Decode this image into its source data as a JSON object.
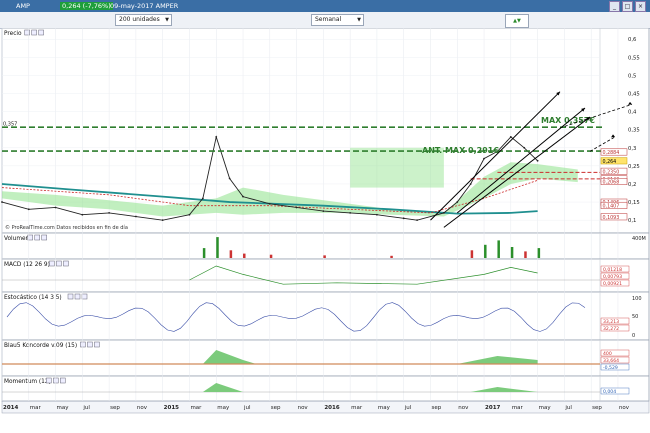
{
  "window": {
    "title": "AMP",
    "change": "0,264 (-7,76%)",
    "date_label": "09-may-2017 AMPER",
    "controls": [
      "_",
      "□",
      "×"
    ]
  },
  "toolbar": {
    "units_select": "200 unidades",
    "period_select": "Semanal"
  },
  "panels": {
    "price_label": "Precio",
    "prt_note": "© ProRealTime.com  Datos recibidos en fin de día",
    "volume_label": "Volumen",
    "macd_label": "MACD (12 26 9)",
    "stoch_label": "Estocástico (14 3 5)",
    "blau_label": "Blau5 Koncorde v.09 (15)",
    "momentum_label": "Momentum (12)"
  },
  "annotations": {
    "max_label": "MAX 0,357€",
    "ant_max_label": "ANT. MAX 0,291€",
    "left_level": "0,357"
  },
  "chart_data": {
    "type": "line",
    "title": "AMPER",
    "period": "Semanal",
    "x_ticks": [
      "2014",
      "mar",
      "may",
      "jul",
      "sep",
      "nov",
      "2015",
      "mar",
      "may",
      "jul",
      "sep",
      "nov",
      "2016",
      "mar",
      "may",
      "jul",
      "sep",
      "nov",
      "2017",
      "mar",
      "may",
      "jul",
      "sep",
      "nov"
    ],
    "y_ticks": [
      "0,6",
      "0,55",
      "0,5",
      "0,45",
      "0,4",
      "0,35",
      "0,3",
      "0,25",
      "0,2",
      "0,15",
      "0,1"
    ],
    "ylim": [
      0.07,
      0.62
    ],
    "price": {
      "x": [
        "2014-01",
        "2014-03",
        "2014-05",
        "2014-07",
        "2014-09",
        "2014-11",
        "2015-01",
        "2015-03",
        "2015-04",
        "2015-05",
        "2015-06",
        "2015-07",
        "2015-09",
        "2015-11",
        "2016-01",
        "2016-03",
        "2016-05",
        "2016-07",
        "2016-08",
        "2016-10",
        "2016-11",
        "2016-12",
        "2017-01",
        "2017-02",
        "2017-03",
        "2017-04",
        "2017-05"
      ],
      "y": [
        0.15,
        0.13,
        0.135,
        0.115,
        0.12,
        0.11,
        0.1,
        0.115,
        0.16,
        0.33,
        0.215,
        0.165,
        0.145,
        0.135,
        0.125,
        0.12,
        0.115,
        0.105,
        0.1,
        0.12,
        0.15,
        0.2,
        0.27,
        0.29,
        0.33,
        0.3,
        0.264
      ]
    },
    "levels": [
      {
        "name": "MAX",
        "value": 0.357,
        "label": "MAX 0,357€"
      },
      {
        "name": "ANT. MAX",
        "value": 0.291,
        "label": "ANT. MAX 0,291€"
      }
    ],
    "price_badges": [
      "0,2884",
      "0,264",
      "0,2350",
      "0,2140",
      "0,2068",
      "0,1496",
      "0,1407",
      "0,1093"
    ],
    "volume_ylim_label": "400M",
    "macd_badges": [
      "0,01218",
      "0,00793",
      "0,00921"
    ],
    "stoch_badges": [
      "33,213",
      "32,272"
    ],
    "blau_badges": [
      "400",
      "33,664",
      "-0,529"
    ],
    "momentum_badges": [
      "0,004"
    ],
    "stoch_ticks": [
      "100",
      "50",
      "0"
    ]
  },
  "colors": {
    "ema_long": "#1f8f8f",
    "cloud": "#8ee28a",
    "max_line": "#2e7d2e",
    "support_red": "#cc2b2b",
    "trend_black": "#000000",
    "candle": "#222222"
  }
}
